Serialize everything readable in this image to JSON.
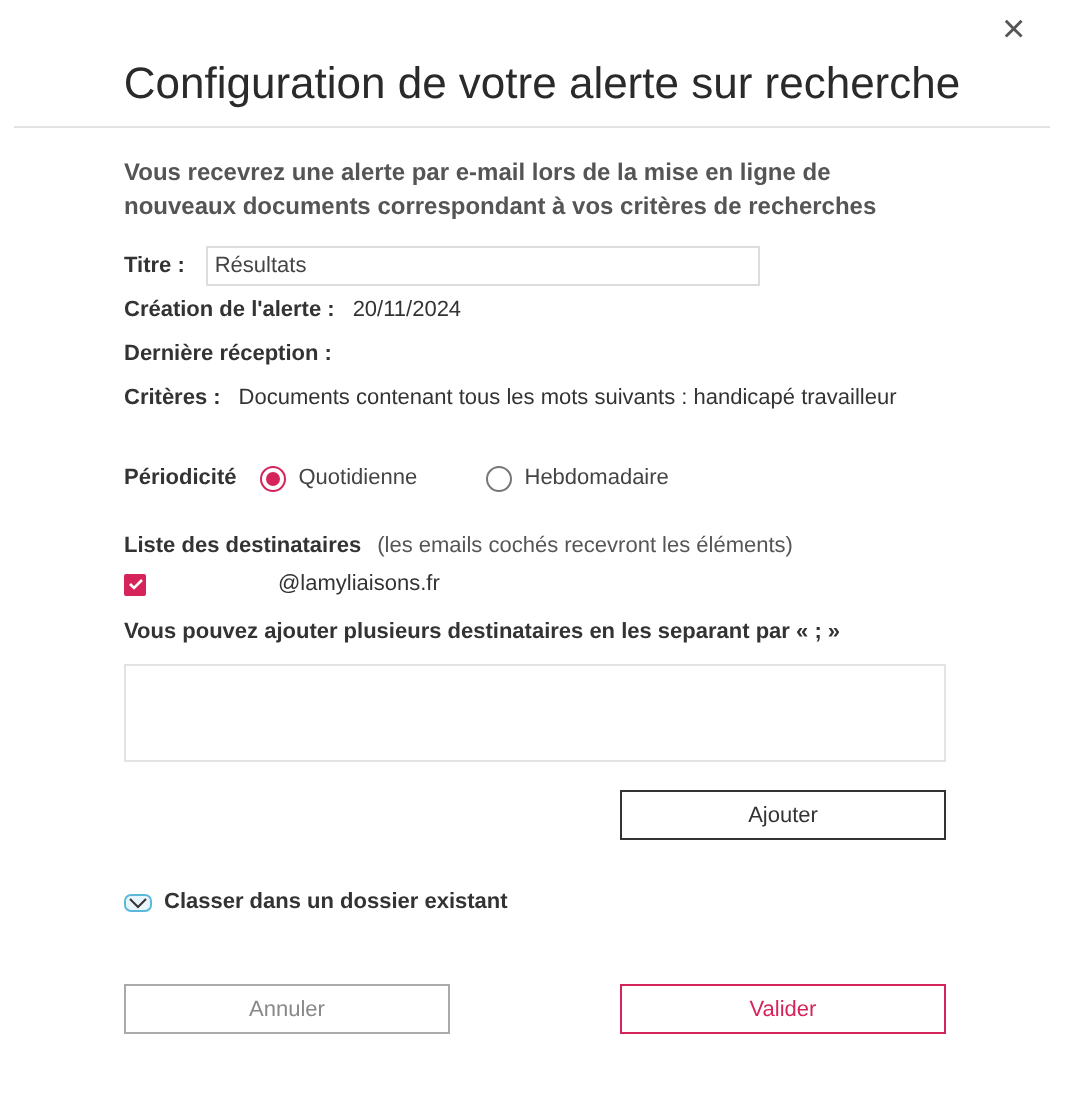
{
  "dialog": {
    "title": "Configuration de votre alerte sur recherche",
    "close": "×",
    "intro": "Vous recevrez une alerte par e-mail lors de la mise en ligne de nouveaux documents correspondant à vos critères de recherches",
    "fields": [
      {
        "kind": "input",
        "label": "Titre :",
        "value": "Résultats"
      },
      {
        "kind": "text",
        "label": "Création de l'alerte :",
        "value": "20/11/2024"
      },
      {
        "kind": "text",
        "label": "Dernière réception :"
      },
      {
        "kind": "text",
        "label": "Critères :",
        "value": "Documents contenant tous les mots suivants : handicapé travailleur"
      }
    ],
    "periodicity": {
      "label": "Périodicité",
      "options": [
        {
          "label": "Quotidienne",
          "selected": true
        },
        {
          "label": "Hebdomadaire",
          "selected": false
        }
      ]
    },
    "recipients": {
      "label": "Liste des destinataires",
      "hint": "(les emails cochés recevront les éléments)",
      "items": [
        {
          "email": "@lamyliaisons.fr",
          "checked": true
        }
      ]
    },
    "add_label": "Vous pouvez ajouter plusieurs destinataires en les separant par **« ; »**",
    "add_button": "Ajouter",
    "folder": {
      "label": "Classer dans un dossier existant"
    },
    "buttons": [
      {
        "kind": "cancel",
        "label": "Annuler"
      },
      {
        "kind": "primary",
        "label": "Valider"
      }
    ]
  }
}
